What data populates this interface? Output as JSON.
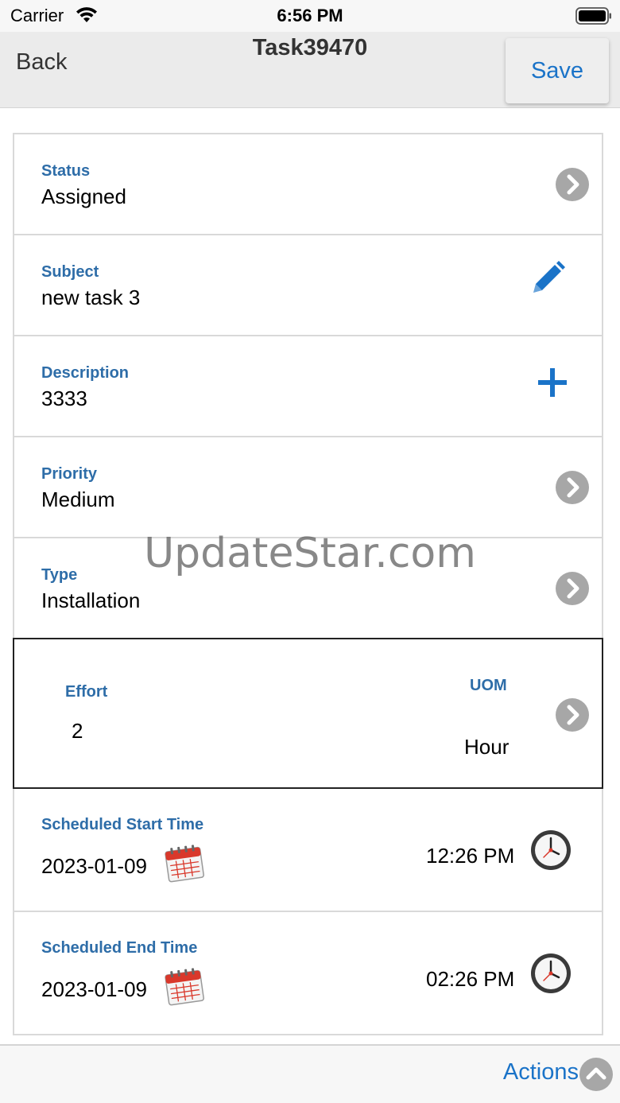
{
  "status_bar": {
    "carrier": "Carrier",
    "time": "6:56 PM"
  },
  "nav": {
    "back_label": "Back",
    "title": "Task39470",
    "save_label": "Save"
  },
  "fields": {
    "status": {
      "label": "Status",
      "value": "Assigned"
    },
    "subject": {
      "label": "Subject",
      "value": "new task 3"
    },
    "description": {
      "label": "Description",
      "value": "3333"
    },
    "priority": {
      "label": "Priority",
      "value": "Medium"
    },
    "type": {
      "label": "Type",
      "value": "Installation"
    },
    "effort": {
      "label": "Effort",
      "value": "2"
    },
    "uom": {
      "label": "UOM",
      "value": "Hour"
    },
    "scheduled_start": {
      "label": "Scheduled Start Time",
      "date": "2023-01-09",
      "time": "12:26 PM"
    },
    "scheduled_end": {
      "label": "Scheduled End Time",
      "date": "2023-01-09",
      "time": "02:26 PM"
    }
  },
  "bottom": {
    "actions_label": "Actions"
  },
  "watermark": "UpdateStar.com",
  "icons": {
    "wifi": "wifi-icon",
    "battery": "battery-icon",
    "chevron": "chevron-right-icon",
    "pencil": "pencil-icon",
    "plus": "plus-icon",
    "calendar": "calendar-icon",
    "clock": "clock-icon",
    "actions_chevron": "chevron-up-icon"
  },
  "colors": {
    "label_blue": "#2e6da8",
    "action_blue": "#1a73c8",
    "chevron_gray": "#a7a7a7",
    "calendar_red": "#d9382b"
  }
}
